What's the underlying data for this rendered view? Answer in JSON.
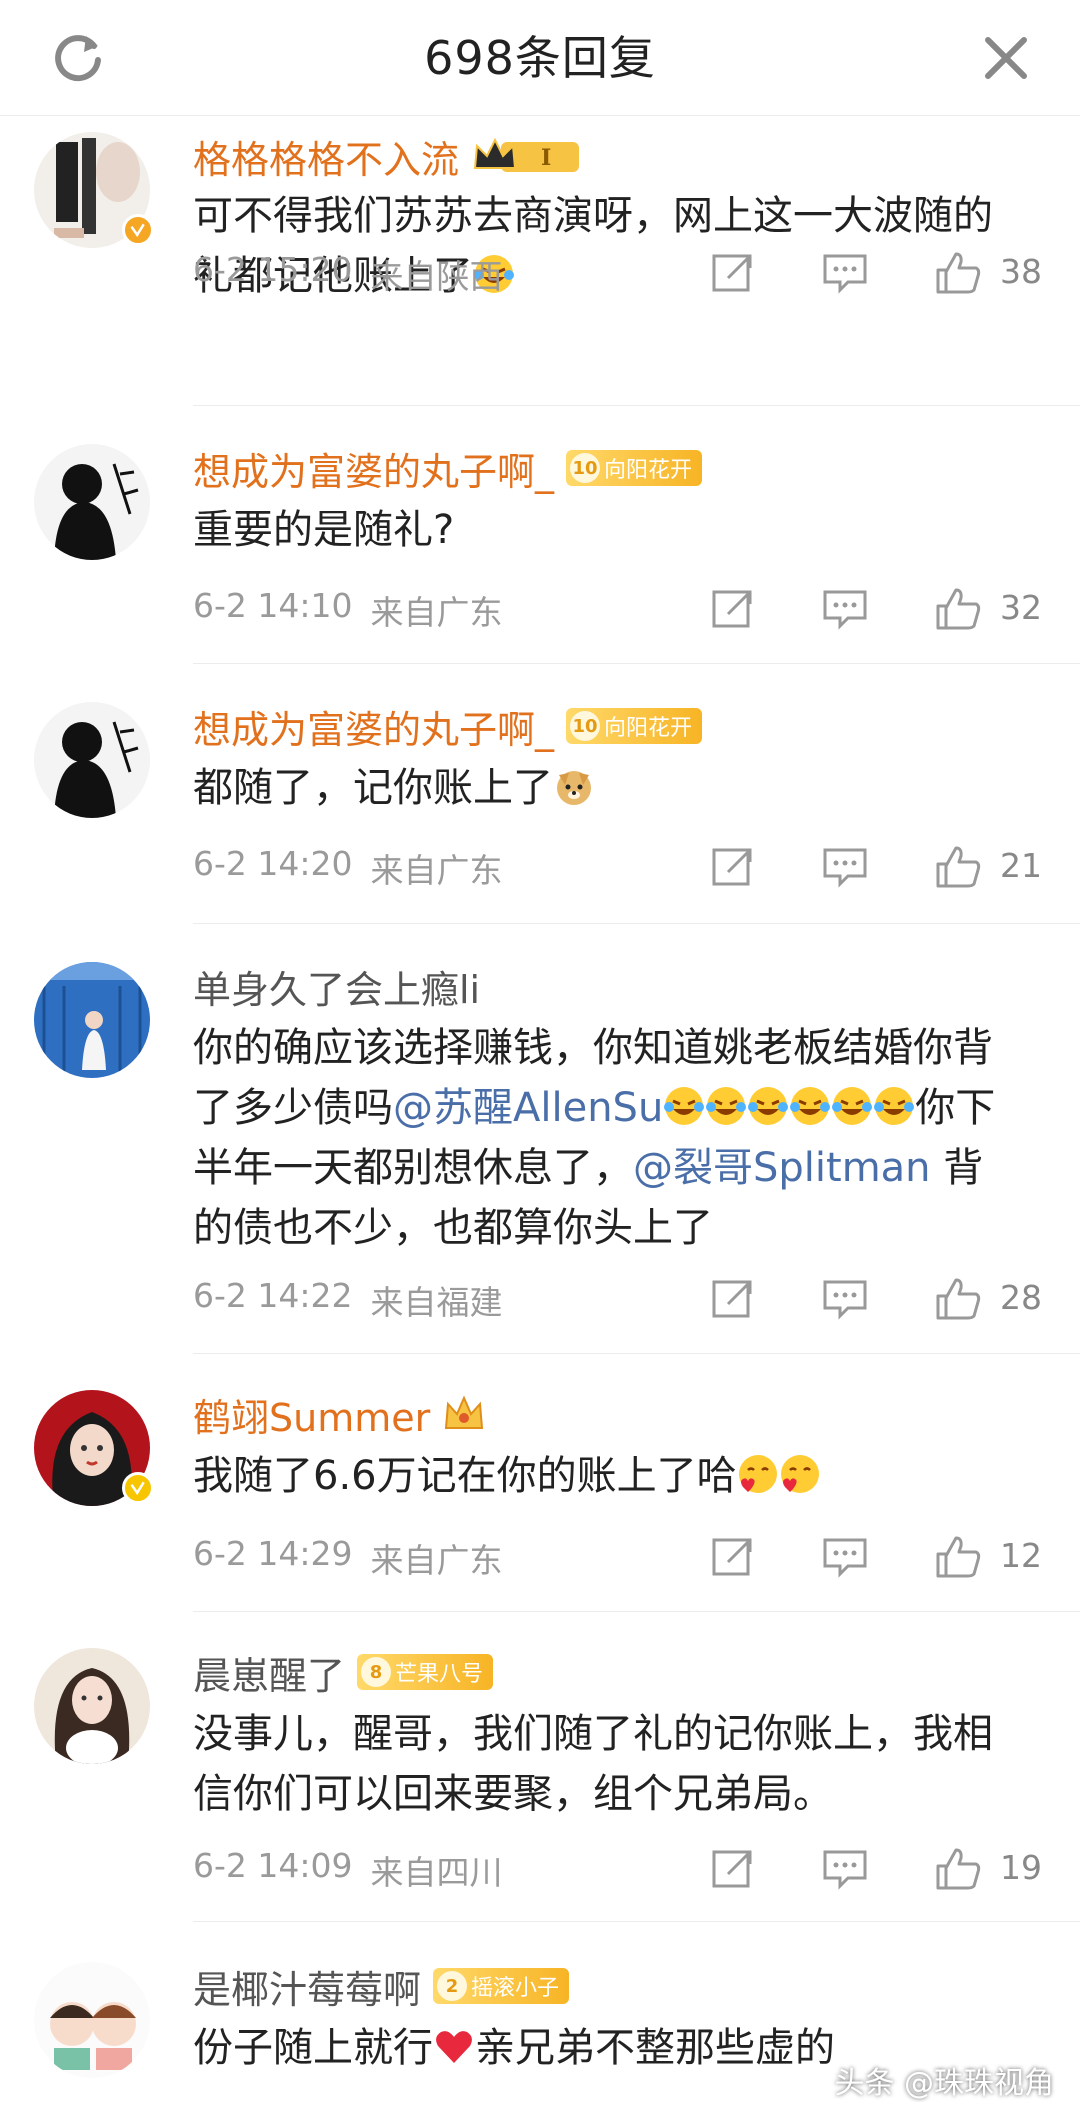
{
  "header": {
    "title": "698条回复"
  },
  "comments": [
    {
      "username": "格格格格不入流",
      "badge": {
        "type": "crown",
        "label": "I"
      },
      "text_parts": [
        "可不得我们苏苏去商演呀，网上这一大波随的礼都记他账上了"
      ],
      "date": "6-2 15:20",
      "location": "来自陕西",
      "likes": "38"
    },
    {
      "username": "想成为富婆的丸子啊_",
      "badge": {
        "type": "level",
        "level": "10",
        "label": "向阳花开"
      },
      "text_parts": [
        "重要的是随礼?"
      ],
      "date": "6-2 14:10",
      "location": "来自广东",
      "likes": "32"
    },
    {
      "username": "想成为富婆的丸子啊_",
      "badge": {
        "type": "level",
        "level": "10",
        "label": "向阳花开"
      },
      "text_parts": [
        "都随了，记你账上了"
      ],
      "date": "6-2 14:20",
      "location": "来自广东",
      "likes": "21"
    },
    {
      "username": "单身久了会上瘾li",
      "text_parts": [
        "你的确应该选择赚钱，你知道姚老板结婚你背了多少债吗",
        "@苏醒AllenSu",
        "你下半年一天都别想休息了，",
        "@裂哥Splitman",
        " 背的债也不少，也都算你头上了"
      ],
      "date": "6-2 14:22",
      "location": "来自福建",
      "likes": "28"
    },
    {
      "username": "鹤翊Summer",
      "text_parts": [
        "我随了6.6万记在你的账上了哈"
      ],
      "date": "6-2 14:29",
      "location": "来自广东",
      "likes": "12"
    },
    {
      "username": "晨崽醒了",
      "badge": {
        "type": "level",
        "level": "8",
        "label": "芒果八号"
      },
      "text_parts": [
        "没事儿，醒哥，我们随了礼的记你账上，我相信你们可以回来要聚，组个兄弟局。"
      ],
      "date": "6-2 14:09",
      "location": "来自四川",
      "likes": "19"
    },
    {
      "username": "是椰汁莓莓啊",
      "badge": {
        "type": "level",
        "level": "2",
        "label": "摇滚小子"
      },
      "text_parts": [
        "份子随上就行",
        "亲兄弟不整那些虚的"
      ]
    }
  ],
  "watermark": "头条 @珠珠视角",
  "colors": {
    "username": "#e2711d",
    "mention": "#4a6ea8",
    "meta": "#9a9a9a",
    "verified": "#f5a623"
  }
}
